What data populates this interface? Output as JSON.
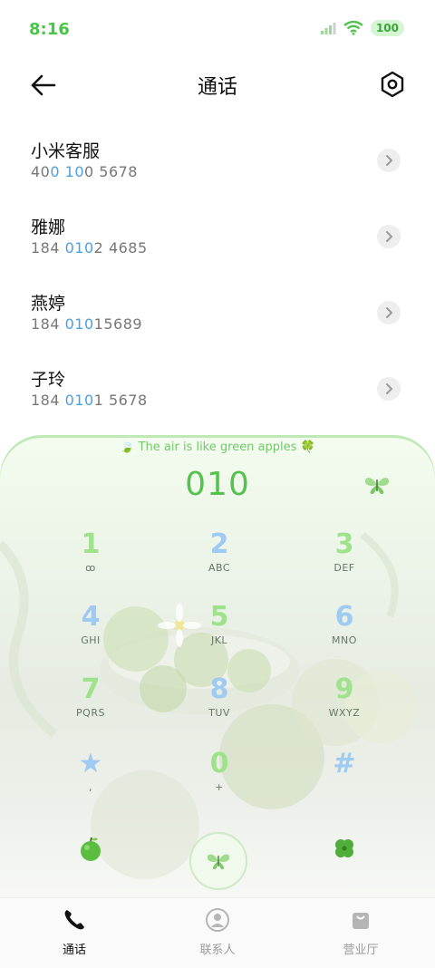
{
  "status": {
    "time": "8:16",
    "battery": "100"
  },
  "header": {
    "title": "通话"
  },
  "contacts": [
    {
      "name": "小米客服",
      "number": [
        {
          "t": "40",
          "h": false
        },
        {
          "t": "0",
          "h": true
        },
        {
          "t": " ",
          "h": false
        },
        {
          "t": "10",
          "h": true
        },
        {
          "t": "0 5678",
          "h": false
        }
      ]
    },
    {
      "name": "雅娜",
      "number": [
        {
          "t": "184 ",
          "h": false
        },
        {
          "t": "010",
          "h": true
        },
        {
          "t": "2 4685",
          "h": false
        }
      ]
    },
    {
      "name": "燕婷",
      "number": [
        {
          "t": "184 ",
          "h": false
        },
        {
          "t": "010",
          "h": true
        },
        {
          "t": "15689",
          "h": false
        }
      ]
    },
    {
      "name": "子玲",
      "number": [
        {
          "t": "184 ",
          "h": false
        },
        {
          "t": "010",
          "h": true
        },
        {
          "t": "1 5678",
          "h": false
        }
      ]
    }
  ],
  "dialer": {
    "slogan": "The air is like green apples",
    "input": "010",
    "keys": [
      {
        "d": "1",
        "s": "ꝏ",
        "c": "green"
      },
      {
        "d": "2",
        "s": "ABC",
        "c": "blue"
      },
      {
        "d": "3",
        "s": "DEF",
        "c": "green"
      },
      {
        "d": "4",
        "s": "GHI",
        "c": "blue"
      },
      {
        "d": "5",
        "s": "JKL",
        "c": "green"
      },
      {
        "d": "6",
        "s": "MNO",
        "c": "blue"
      },
      {
        "d": "7",
        "s": "PQRS",
        "c": "green"
      },
      {
        "d": "8",
        "s": "TUV",
        "c": "blue"
      },
      {
        "d": "9",
        "s": "WXYZ",
        "c": "green"
      },
      {
        "d": "★",
        "s": ",",
        "c": "blue"
      },
      {
        "d": "0",
        "s": "+",
        "c": "green"
      },
      {
        "d": "#",
        "s": "",
        "c": "blue"
      }
    ]
  },
  "nav": {
    "calls": "通话",
    "contacts": "联系人",
    "store": "营业厅"
  },
  "colors": {
    "accent_green": "#55c24f",
    "accent_blue": "#4b9fe6"
  }
}
